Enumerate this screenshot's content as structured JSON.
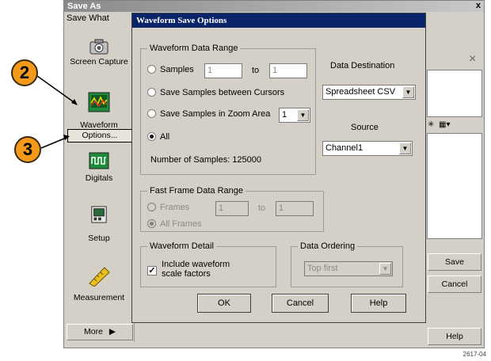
{
  "outer": {
    "title": "Save As",
    "close_label": "x",
    "save_what_label": "Save What",
    "sidebar": [
      {
        "label": "Screen Capture",
        "icon": "camera-icon"
      },
      {
        "label": "Waveform",
        "icon": "waveform-icon"
      },
      {
        "label": "Digitals",
        "icon": "digitals-icon"
      },
      {
        "label": "Setup",
        "icon": "setup-icon"
      },
      {
        "label": "Measurement",
        "icon": "ruler-icon"
      }
    ],
    "options_label": "Options...",
    "more_label": "More",
    "right_close_label": "×",
    "save_label": "Save",
    "cancel_label": "Cancel",
    "help_label": "Help"
  },
  "dialog": {
    "title": "Waveform Save Options",
    "data_range": {
      "legend": "Waveform Data Range",
      "samples_label": "Samples",
      "samples_from": "1",
      "to_label": "to",
      "samples_to": "1",
      "cursors_label": "Save Samples between Cursors",
      "zoom_label": "Save Samples in Zoom Area",
      "zoom_value": "1",
      "all_label": "All",
      "num_samples_label": "Number of Samples: 125000"
    },
    "destination": {
      "label": "Data Destination",
      "value": "Spreadsheet CSV"
    },
    "source": {
      "label": "Source",
      "value": "Channel1"
    },
    "fast_frame": {
      "legend": "Fast Frame Data Range",
      "frames_label": "Frames",
      "frames_from": "1",
      "to_label": "to",
      "frames_to": "1",
      "all_frames_label": "All Frames"
    },
    "detail": {
      "legend": "Waveform Detail",
      "checkbox_label_1": "Include waveform",
      "checkbox_label_2": "scale factors"
    },
    "ordering": {
      "legend": "Data Ordering",
      "value": "Top first"
    },
    "ok_label": "OK",
    "cancel_label": "Cancel",
    "help_label": "Help"
  },
  "callouts": [
    "2",
    "3"
  ],
  "figure_number": "2617-04"
}
